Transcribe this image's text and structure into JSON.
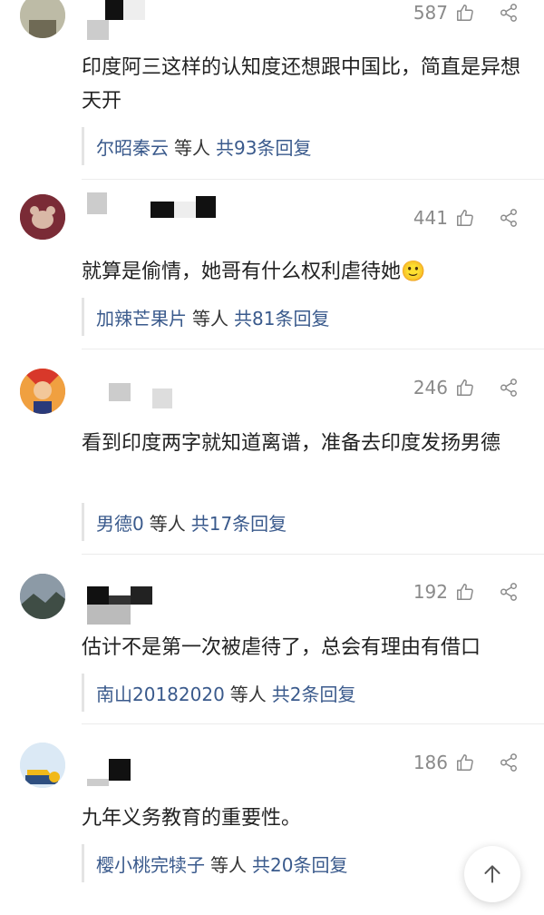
{
  "comments": [
    {
      "likes": "587",
      "text": "印度阿三这样的认知度还想跟中国比，简直是异想天开",
      "reply": {
        "name": "尔昭秦云",
        "mid": "等人",
        "total": "共93条回复"
      }
    },
    {
      "likes": "441",
      "text": "就算是偷情，她哥有什么权利虐待她🙂",
      "reply": {
        "name": "加辣芒果片",
        "mid": "等人",
        "total": "共81条回复"
      }
    },
    {
      "likes": "246",
      "text": "看到印度两字就知道离谱，准备去印度发扬男德",
      "reply": {
        "name": "男德0",
        "mid": "等人",
        "total": "共17条回复"
      }
    },
    {
      "likes": "192",
      "text": "估计不是第一次被虐待了，总会有理由有借口",
      "reply": {
        "name": "南山20182020",
        "mid": "等人",
        "total": "共2条回复"
      }
    },
    {
      "likes": "186",
      "text": "九年义务教育的重要性。",
      "reply": {
        "name": "樱小桃完犊子",
        "mid": "等人",
        "total": "共20条回复"
      }
    }
  ],
  "icons": {
    "like": "thumbs-up-icon",
    "share": "share-icon",
    "scroll_top": "arrow-up-icon"
  },
  "colors": {
    "reply_link": "#3a5a8c",
    "muted": "#8a8a8a"
  }
}
